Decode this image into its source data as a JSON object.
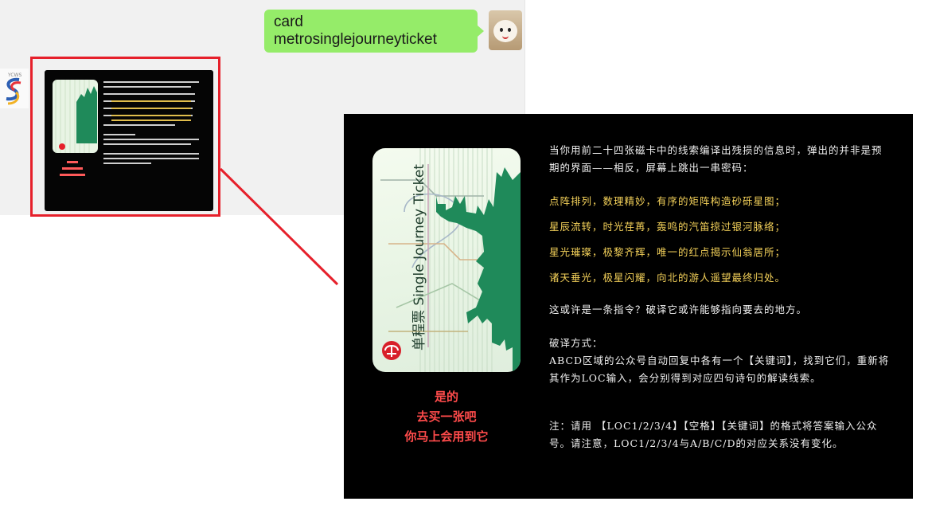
{
  "chat": {
    "user_message": "card metrosinglejourneyticket"
  },
  "image": {
    "card": {
      "title_cn": "单程票",
      "title_en": "Single Journey Ticket"
    },
    "caption": [
      "是的",
      "去买一张吧",
      "你马上会用到它"
    ],
    "intro": "当你用前二十四张磁卡中的线索编译出残损的信息时，弹出的并非是预期的界面——相反，屏幕上跳出一串密码：",
    "poem": [
      "点阵排列，数理精妙，有序的矩阵构造砂砾星图；",
      "星辰流转，时光荏苒，轰鸣的汽笛掠过银河脉络；",
      "星光璀璨，极黎齐辉，唯一的红点揭示仙翁居所；",
      "诸天垂光，极星闪耀，向北的游人遥望最终归处。"
    ],
    "hint": "这或许是一条指令？破译它或许能够指向要去的地方。",
    "method_title": "破译方式：",
    "method_body": "ABCD区域的公众号自动回复中各有一个【关键词】，找到它们，重新将其作为LOC输入，会分别得到对应四句诗句的解读线索。",
    "note": "注：请用 【LOC1/2/3/4】【空格】【关键词】的格式将答案输入公众号。请注意，LOC1/2/3/4与A/B/C/D的对应关系没有变化。"
  },
  "colors": {
    "bubble": "#95ec69",
    "highlight": "#e6202b",
    "poem": "#f5d25a",
    "caption": "#ff4b4b",
    "card_green": "#1f8a5a"
  },
  "icons": [
    "avatar-user-icon",
    "avatar-bot-icon",
    "metro-logo-icon"
  ]
}
